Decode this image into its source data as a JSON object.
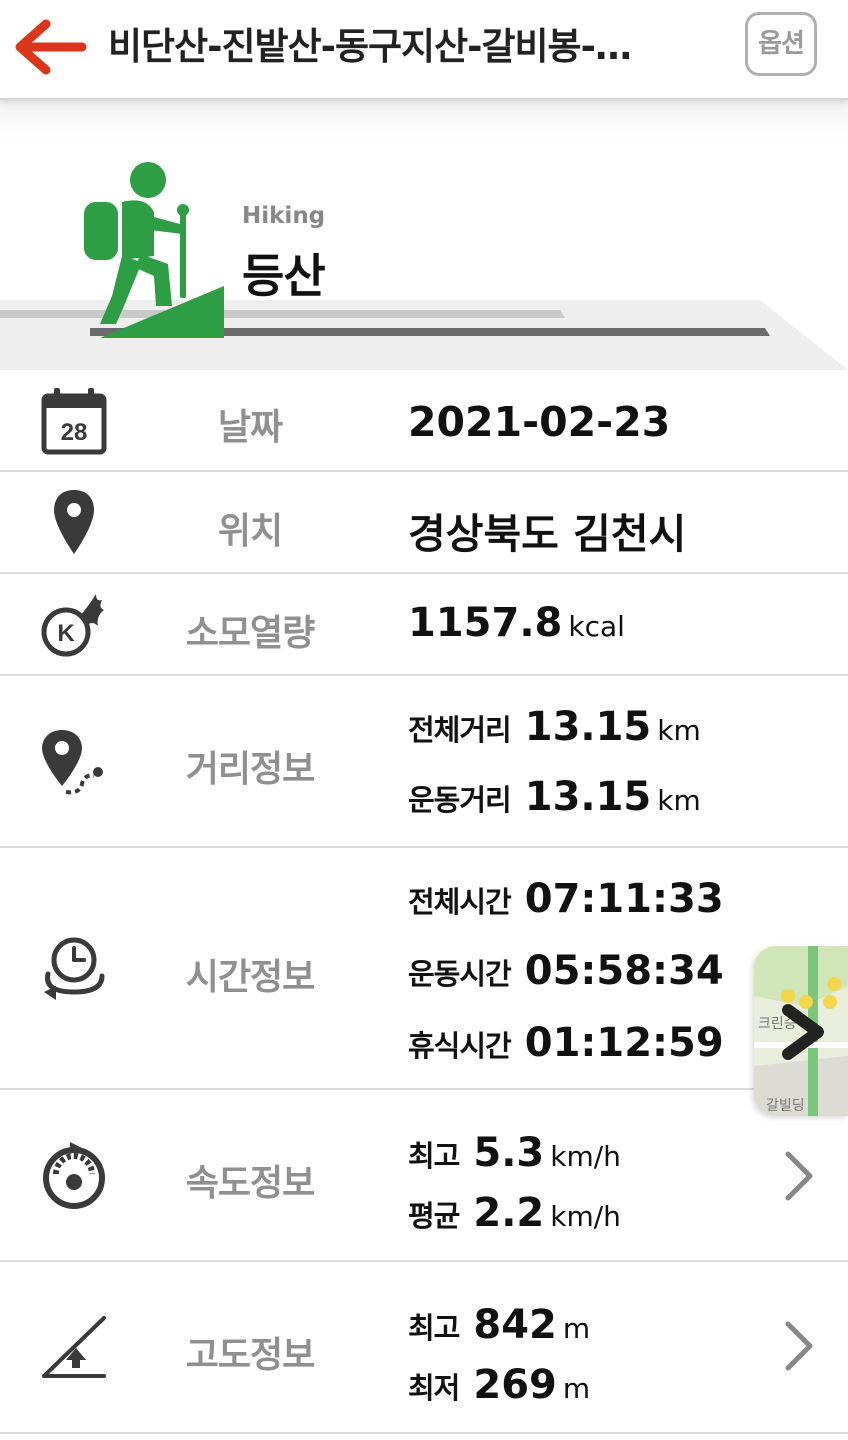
{
  "header": {
    "title": "비단산-진밭산-동구지산-갈비봉-…",
    "option_label": "옵션"
  },
  "hero": {
    "activity_en": "Hiking",
    "activity_ko": "등산"
  },
  "date": {
    "icon_day": "28",
    "label": "날짜",
    "value": "2021-02-23"
  },
  "location": {
    "label": "위치",
    "value": "경상북도 김천시"
  },
  "calories": {
    "icon_letter": "K",
    "label": "소모열량",
    "value": "1157.8",
    "unit": "kcal"
  },
  "distance": {
    "label": "거리정보",
    "total_label": "전체거리",
    "total_value": "13.15",
    "exercise_label": "운동거리",
    "exercise_value": "13.15",
    "unit": "km"
  },
  "time": {
    "label": "시간정보",
    "total_label": "전체시간",
    "total_value": "07:11:33",
    "exercise_label": "운동시간",
    "exercise_value": "05:58:34",
    "rest_label": "휴식시간",
    "rest_value": "01:12:59"
  },
  "speed": {
    "label": "속도정보",
    "max_label": "최고",
    "max_value": "5.3",
    "avg_label": "평균",
    "avg_value": "2.2",
    "unit": "km/h"
  },
  "altitude": {
    "label": "고도정보",
    "max_label": "최고",
    "max_value": "842",
    "min_label": "최저",
    "min_value": "269",
    "unit": "m"
  },
  "map_preview": {
    "label_1": "크린승",
    "label_2": "갈빌딩"
  },
  "colors": {
    "accent_red": "#d9361b",
    "hiker_green": "#2e9e45",
    "label_gray": "#909090",
    "icon_dark": "#3a3a3a"
  }
}
